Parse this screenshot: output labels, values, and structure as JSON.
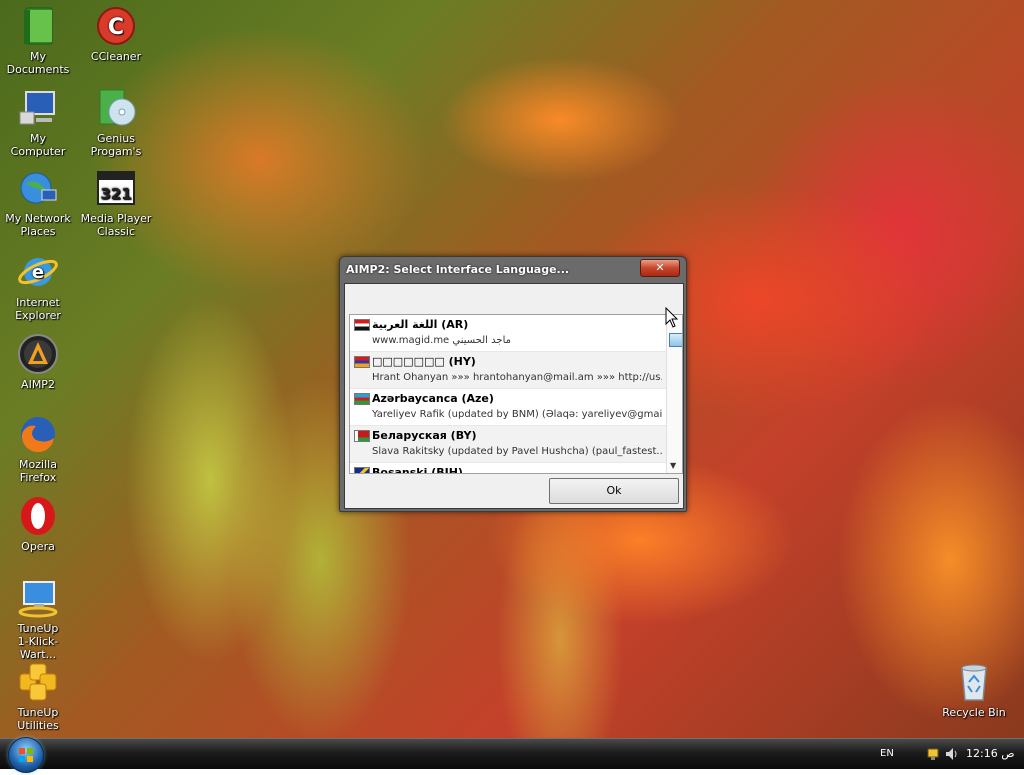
{
  "desktop": {
    "icons": [
      {
        "name": "my-documents",
        "label": "My Documents",
        "icon": "folder-icon"
      },
      {
        "name": "ccleaner",
        "label": "CCleaner",
        "icon": "ccleaner-icon"
      },
      {
        "name": "my-computer",
        "label": "My Computer",
        "icon": "computer-icon"
      },
      {
        "name": "genius-programs",
        "label": "Genius\nProgam's",
        "icon": "cd-icon"
      },
      {
        "name": "my-network-places",
        "label": "My Network\nPlaces",
        "icon": "network-icon"
      },
      {
        "name": "media-player-classic",
        "label": "Media Player\nClassic",
        "icon": "media-player-icon"
      },
      {
        "name": "internet-explorer",
        "label": "Internet\nExplorer",
        "icon": "internet-explorer-icon"
      },
      {
        "name": "aimp2",
        "label": "AIMP2",
        "icon": "aimp-icon"
      },
      {
        "name": "mozilla-firefox",
        "label": "Mozilla Firefox",
        "icon": "firefox-icon"
      },
      {
        "name": "opera",
        "label": "Opera",
        "icon": "opera-icon"
      },
      {
        "name": "tuneup-1-klick",
        "label": "TuneUp\n1-Klick-Wart...",
        "icon": "tuneup-monitor-icon"
      },
      {
        "name": "tuneup-utilities",
        "label": "TuneUp Utilities",
        "icon": "tuneup-icon"
      },
      {
        "name": "recycle-bin",
        "label": "Recycle Bin",
        "icon": "recycle-bin-icon"
      }
    ],
    "media_player_number": "321"
  },
  "dialog": {
    "title": "AIMP2: Select Interface Language...",
    "close_label": "✕",
    "ok_label": "Ok",
    "languages": [
      {
        "name": "اللغة العربية (AR)",
        "author": "www.magid.me ماجد الحسيني",
        "flag": "syria"
      },
      {
        "name": "□□□□□□□ (HY)",
        "author": "Hrant Ohanyan »»» hrantohanyan@mail.am »»» http://us...",
        "flag": "armenia"
      },
      {
        "name": "Azərbaycanca (Aze)",
        "author": "Yareliyev Rafik (updated by BNM) (Əlaqə: yareliyev@gmai...",
        "flag": "azerbaijan"
      },
      {
        "name": "Беларуская (BY)",
        "author": "Slava Rakitsky (updated by Pavel Hushcha) (paul_fastest...",
        "flag": "belarus"
      },
      {
        "name": "Bosanski (BIH)",
        "author": "",
        "flag": "bosnia"
      }
    ]
  },
  "taskbar": {
    "language": "EN",
    "clock": "12:16 ص"
  }
}
